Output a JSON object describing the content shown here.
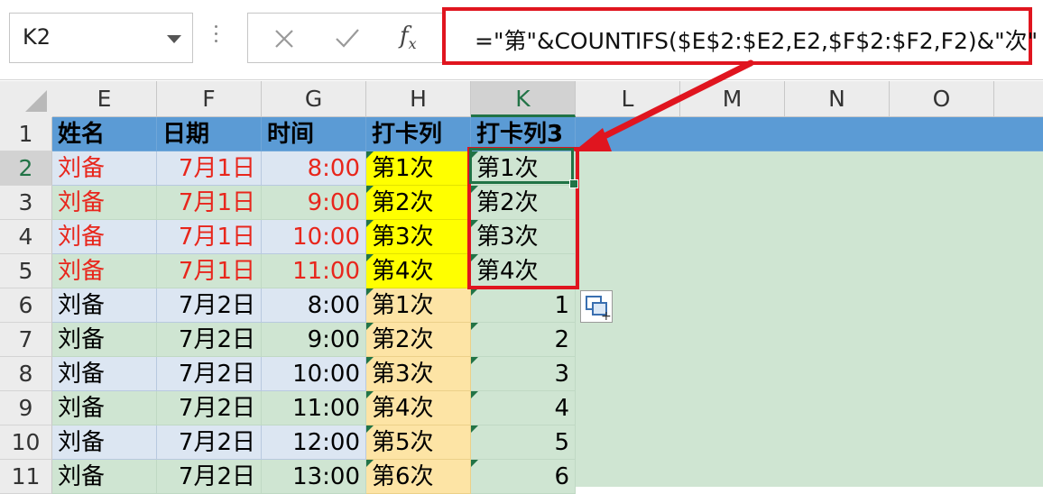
{
  "formula_bar": {
    "name_box": "K2",
    "formula": "=\"第\"&COUNTIFS($E$2:$E2,E2,$F$2:$F2,F2)&\"次\"",
    "fx_label": "fx"
  },
  "columns": [
    "E",
    "F",
    "G",
    "H",
    "K",
    "L",
    "M",
    "N",
    "O"
  ],
  "rows": [
    "1",
    "2",
    "3",
    "4",
    "5",
    "6",
    "7",
    "8",
    "9",
    "10",
    "11"
  ],
  "header": {
    "name": "姓名",
    "date": "日期",
    "time": "时间",
    "punch": "打卡列",
    "punch3": "打卡列3"
  },
  "data_rows": [
    {
      "name": "刘备",
      "date": "7月1日",
      "time": "8:00",
      "punch": "第1次",
      "k": "第1次"
    },
    {
      "name": "刘备",
      "date": "7月1日",
      "time": "9:00",
      "punch": "第2次",
      "k": "第2次"
    },
    {
      "name": "刘备",
      "date": "7月1日",
      "time": "10:00",
      "punch": "第3次",
      "k": "第3次"
    },
    {
      "name": "刘备",
      "date": "7月1日",
      "time": "11:00",
      "punch": "第4次",
      "k": "第4次"
    },
    {
      "name": "刘备",
      "date": "7月2日",
      "time": "8:00",
      "punch": "第1次",
      "k": "1"
    },
    {
      "name": "刘备",
      "date": "7月2日",
      "time": "9:00",
      "punch": "第2次",
      "k": "2"
    },
    {
      "name": "刘备",
      "date": "7月2日",
      "time": "10:00",
      "punch": "第3次",
      "k": "3"
    },
    {
      "name": "刘备",
      "date": "7月2日",
      "time": "11:00",
      "punch": "第4次",
      "k": "4"
    },
    {
      "name": "刘备",
      "date": "7月2日",
      "time": "12:00",
      "punch": "第5次",
      "k": "5"
    },
    {
      "name": "刘备",
      "date": "7月2日",
      "time": "13:00",
      "punch": "第6次",
      "k": "6"
    }
  ],
  "colors": {
    "header_blue": "#5b9bd5",
    "red_text": "#e8261c",
    "yellow": "#ffff00",
    "orange": "#fde4a5",
    "green_fill": "#cfe5d2",
    "blue_fill": "#dce6f2",
    "annotation_red": "#e0151f",
    "excel_green": "#217346"
  }
}
